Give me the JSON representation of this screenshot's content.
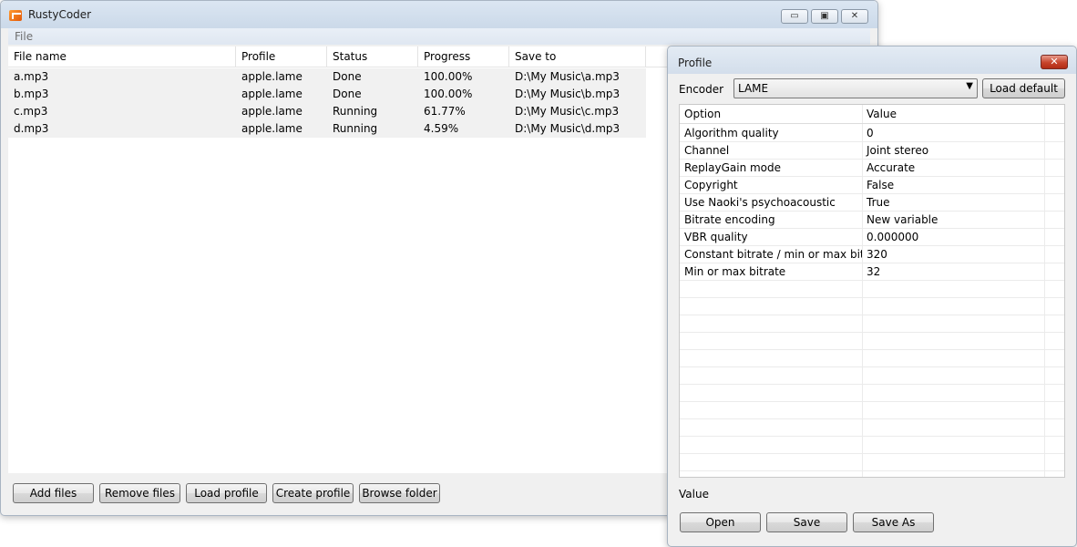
{
  "main_window": {
    "title": "RustyCoder",
    "menu": {
      "file": "File"
    },
    "columns": [
      "File name",
      "Profile",
      "Status",
      "Progress",
      "Save to"
    ],
    "rows": [
      [
        "a.mp3",
        "apple.lame",
        "Done",
        "100.00%",
        "D:\\My Music\\a.mp3"
      ],
      [
        "b.mp3",
        "apple.lame",
        "Done",
        "100.00%",
        "D:\\My Music\\b.mp3"
      ],
      [
        "c.mp3",
        "apple.lame",
        "Running",
        "61.77%",
        "D:\\My Music\\c.mp3"
      ],
      [
        "d.mp3",
        "apple.lame",
        "Running",
        "4.59%",
        "D:\\My Music\\d.mp3"
      ]
    ],
    "buttons": {
      "add_files": "Add files",
      "remove_files": "Remove files",
      "load_profile": "Load profile",
      "create_profile": "Create profile",
      "browse_folder": "Browse folder"
    },
    "controls": {
      "minimize": "▭",
      "restore": "▣",
      "close": "✕"
    }
  },
  "profile_window": {
    "title": "Profile",
    "close": "✕",
    "encoder_label": "Encoder",
    "encoder_value": "LAME",
    "dropdown_arrow": "▼",
    "load_default": "Load default",
    "columns": [
      "Option",
      "Value"
    ],
    "options": [
      [
        "Algorithm quality",
        "0"
      ],
      [
        "Channel",
        "Joint stereo"
      ],
      [
        "ReplayGain mode",
        "Accurate"
      ],
      [
        "Copyright",
        "False"
      ],
      [
        "Use Naoki's psychoacoustic",
        "True"
      ],
      [
        "Bitrate encoding",
        "New variable"
      ],
      [
        "VBR quality",
        "0.000000"
      ],
      [
        "Constant bitrate / min or max bitra...",
        "320"
      ],
      [
        "Min or max bitrate",
        "32"
      ]
    ],
    "value_label": "Value",
    "buttons": {
      "open": "Open",
      "save": "Save",
      "save_as": "Save As"
    }
  }
}
